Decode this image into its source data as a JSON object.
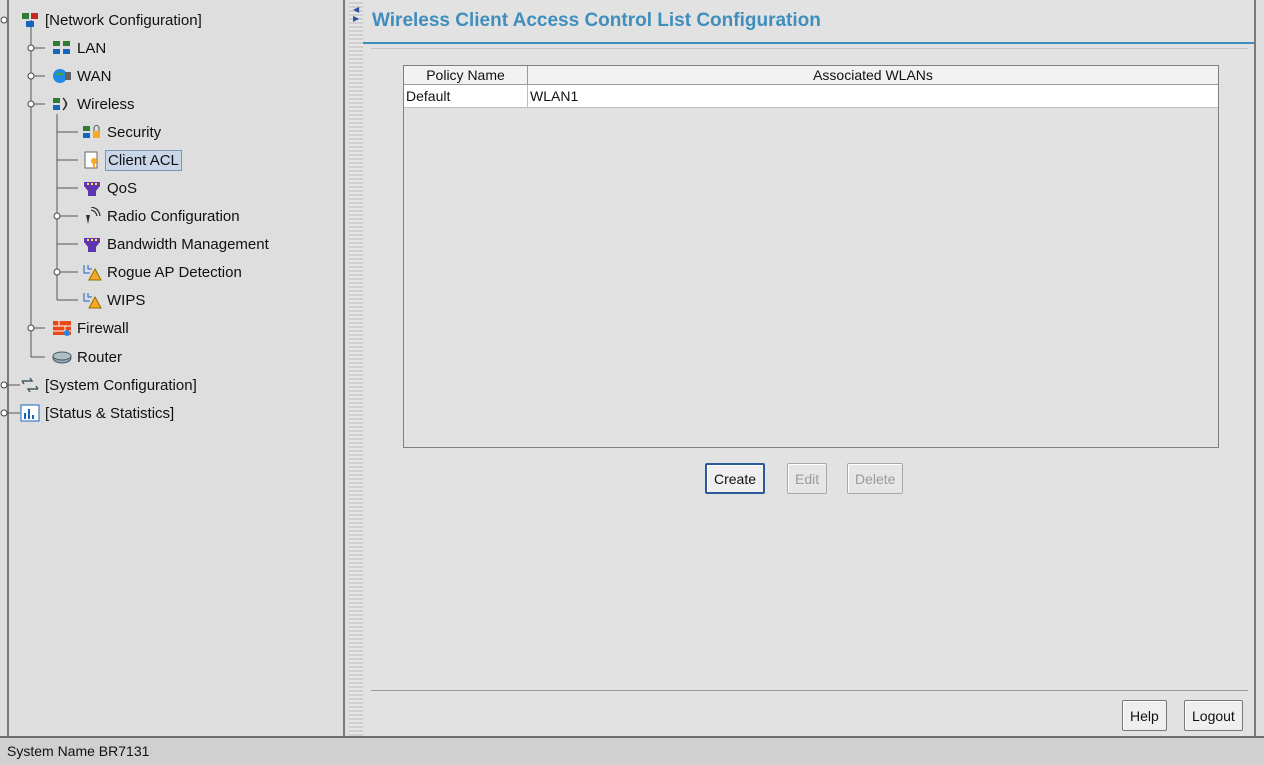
{
  "tree": {
    "items": [
      {
        "label": "[Network Configuration]",
        "icon": "network-config-icon"
      },
      {
        "label": "LAN",
        "icon": "lan-icon"
      },
      {
        "label": "WAN",
        "icon": "wan-icon"
      },
      {
        "label": "Wireless",
        "icon": "wireless-icon"
      },
      {
        "label": "Security",
        "icon": "security-icon"
      },
      {
        "label": "Client ACL",
        "icon": "client-acl-icon",
        "selected": true
      },
      {
        "label": "QoS",
        "icon": "qos-icon"
      },
      {
        "label": "Radio Configuration",
        "icon": "radio-icon"
      },
      {
        "label": "Bandwidth Management",
        "icon": "bandwidth-icon"
      },
      {
        "label": "Rogue AP Detection",
        "icon": "rogue-ap-icon"
      },
      {
        "label": "WIPS",
        "icon": "wips-icon"
      },
      {
        "label": "Firewall",
        "icon": "firewall-icon"
      },
      {
        "label": "Router",
        "icon": "router-icon"
      },
      {
        "label": "[System Configuration]",
        "icon": "system-config-icon"
      },
      {
        "label": "[Status & Statistics]",
        "icon": "statistics-icon"
      }
    ]
  },
  "content": {
    "title": "Wireless Client Access Control List Configuration",
    "table": {
      "columns": [
        "Policy Name",
        "Associated WLANs"
      ],
      "rows": [
        [
          "Default",
          "WLAN1"
        ]
      ]
    },
    "buttons": {
      "create": "Create",
      "edit": "Edit",
      "delete": "Delete"
    }
  },
  "footer": {
    "help": "Help",
    "logout": "Logout"
  },
  "status": {
    "system_name": "System Name BR7131"
  },
  "colors": {
    "accent": "#3f8ebd",
    "selection": "#c9d6e8"
  }
}
